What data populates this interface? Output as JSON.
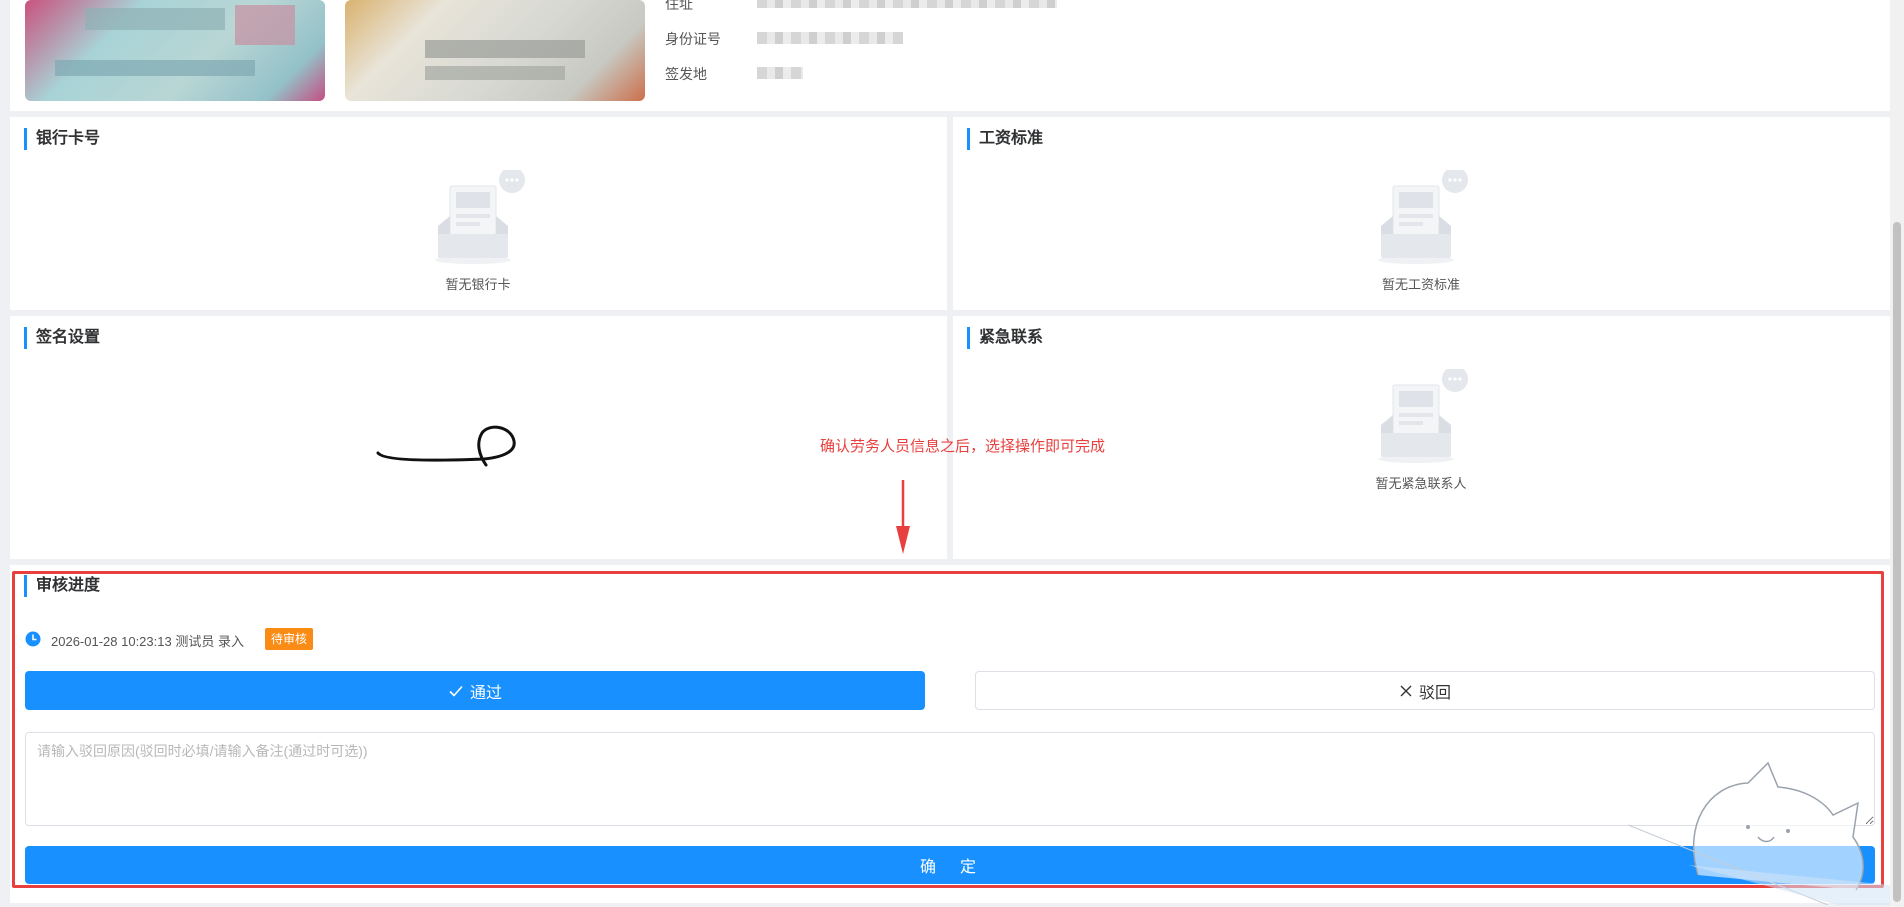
{
  "top_info": {
    "address_label": "住址",
    "id_label": "身份证号",
    "issuer_label": "签发地"
  },
  "bank_card": {
    "title": "银行卡号",
    "empty_text": "暂无银行卡"
  },
  "salary": {
    "title": "工资标准",
    "empty_text": "暂无工资标准"
  },
  "signature": {
    "title": "签名设置"
  },
  "emergency": {
    "title": "紧急联系",
    "empty_text": "暂无紧急联系人"
  },
  "annotation": {
    "text": "确认劳务人员信息之后，选择操作即可完成",
    "color": "#e8403f"
  },
  "review": {
    "title": "审核进度",
    "entry_time": "2026-01-28 10:23:13",
    "entry_user": "测试员",
    "entry_action": "录入",
    "status_badge": "待审核",
    "approve_label": "通过",
    "reject_label": "驳回",
    "remark_placeholder": "请输入驳回原因(驳回时必填/请输入备注(通过时可选))",
    "confirm_label": "确　定"
  },
  "colors": {
    "primary": "#1890ff",
    "badge": "#fa8c16",
    "highlight_border": "#e8403f"
  }
}
